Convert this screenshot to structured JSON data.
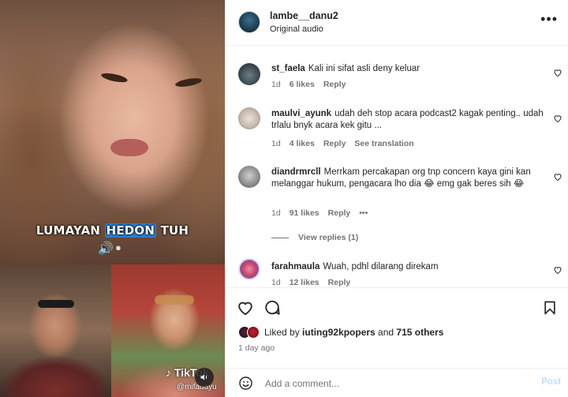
{
  "media": {
    "subtitle_pre": "LUMAYAN ",
    "subtitle_hl": "HEDON",
    "subtitle_post": " TUH",
    "tiktok_logo": "TikTok",
    "tiktok_handle": "@mifauayu"
  },
  "header": {
    "username": "lambe__danu2",
    "audio": "Original audio",
    "more": "•••"
  },
  "comments": [
    {
      "user": "st_faela",
      "text": "Kali ini sifat asli deny keluar",
      "age": "1d",
      "likes": "6 likes",
      "reply": "Reply"
    },
    {
      "user": "maulvi_ayunk",
      "text": "udah deh stop acara podcast2 kagak penting.. udah trlalu bnyk acara kek gitu ...",
      "age": "1d",
      "likes": "4 likes",
      "reply": "Reply",
      "translate": "See translation"
    },
    {
      "user": "diandrmrcll",
      "text": "Merrkam percakapan org tnp concern kaya gini kan melanggar hukum, pengacara lho dia 😂 emg gak beres sih 😂",
      "age": "1d",
      "likes": "91 likes",
      "reply": "Reply",
      "more": "•••",
      "view_replies": "View replies (1)"
    },
    {
      "user": "farahmaula",
      "text": "Wuah, pdhl dilarang direkam",
      "age": "1d",
      "likes": "12 likes",
      "reply": "Reply"
    }
  ],
  "likes": {
    "prefix": "Liked by ",
    "user": "iuting92kpopers",
    "middle": " and ",
    "others": "715 others"
  },
  "posted": "1 day ago",
  "add_comment": {
    "placeholder": "Add a comment...",
    "post": "Post"
  },
  "icons": {
    "like": "heart-icon",
    "comment": "comment-icon",
    "save": "bookmark-icon",
    "emoji": "emoji-icon",
    "more": "more-icon",
    "mute": "speaker-icon"
  }
}
